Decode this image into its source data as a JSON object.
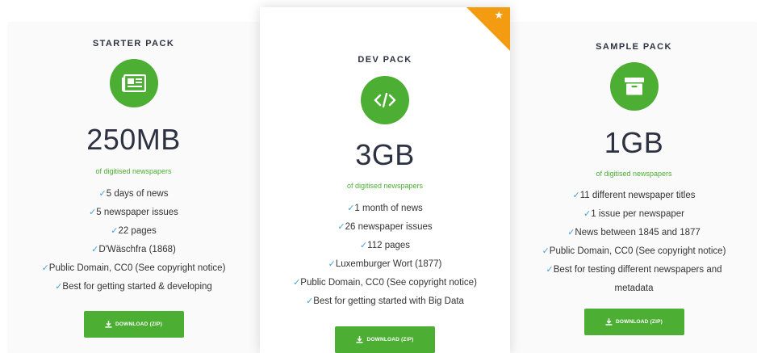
{
  "cards": [
    {
      "id": "starter",
      "title": "STARTER PACK",
      "icon": "newspaper-icon",
      "size": "250MB",
      "subtitle": "of digitised newspapers",
      "features": [
        "5 days of news",
        "5 newspaper issues",
        "22 pages",
        "D'Wäschfra (1868)",
        "Public Domain, CC0 (See copyright notice)",
        "Best for getting started & developing"
      ],
      "button": "DOWNLOAD (ZIP)"
    },
    {
      "id": "dev",
      "title": "DEV PACK",
      "icon": "code-icon",
      "featured": true,
      "ribbon_icon": "star-icon",
      "size": "3GB",
      "subtitle": "of digitised newspapers",
      "features": [
        "1 month of news",
        "26 newspaper issues",
        "112 pages",
        "Luxemburger Wort (1877)",
        "Public Domain, CC0 (See copyright notice)",
        "Best for getting started with Big Data"
      ],
      "button": "DOWNLOAD (ZIP)"
    },
    {
      "id": "sample",
      "title": "SAMPLE PACK",
      "icon": "archive-box-icon",
      "size": "1GB",
      "subtitle": "of digitised newspapers",
      "features": [
        "11 different newspaper titles",
        "1 issue per newspaper",
        "News between 1845 and 1877",
        "Public Domain, CC0 (See copyright notice)",
        "Best for testing different newspapers and metadata"
      ],
      "button": "DOWNLOAD (ZIP)"
    }
  ],
  "check_glyph": "✓",
  "colors": {
    "accent_green": "#4caf33",
    "ribbon_orange": "#f39c12",
    "check_blue": "#4aa0d8",
    "heading": "#2d3242"
  }
}
